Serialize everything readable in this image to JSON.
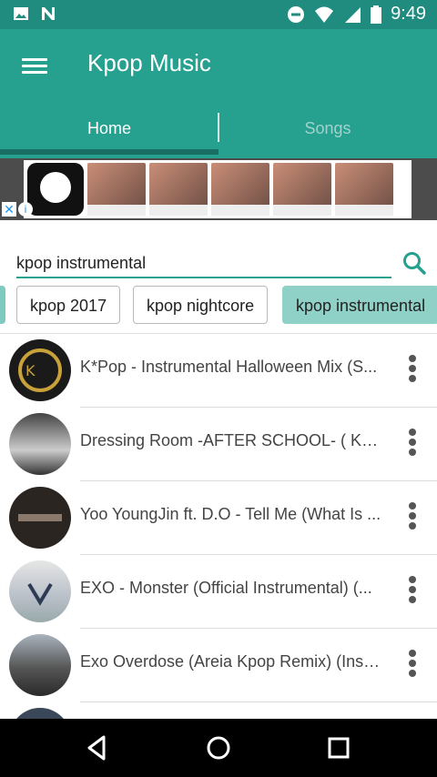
{
  "status_bar": {
    "time": "9:49"
  },
  "app_bar": {
    "title": "Kpop Music",
    "menu_icon": "hamburger-menu-icon"
  },
  "tabs": [
    {
      "label": "Home",
      "selected": true
    },
    {
      "label": "Songs",
      "selected": false
    }
  ],
  "ad_banner": {
    "close_icon": "close-icon",
    "info_icon": "info-icon"
  },
  "search": {
    "value": "kpop instrumental"
  },
  "chips": [
    "kpop 2017",
    "kpop nightcore",
    "kpop instrumental"
  ],
  "songs": [
    {
      "title": "K*Pop - Instrumental Halloween Mix (S..."
    },
    {
      "title": "Dressing Room -AFTER SCHOOL- ( KP..."
    },
    {
      "title": "Yoo YoungJin ft. D.O - Tell Me (What Is ..."
    },
    {
      "title": "EXO - Monster (Official Instrumental) (..."
    },
    {
      "title": "Exo Overdose (Areia Kpop Remix) (Instr..."
    }
  ],
  "colors": {
    "primary": "#26a08f",
    "status": "#1f8c7f",
    "indicator": "#1a6f64",
    "chip_selected": "#8fd1c7"
  }
}
